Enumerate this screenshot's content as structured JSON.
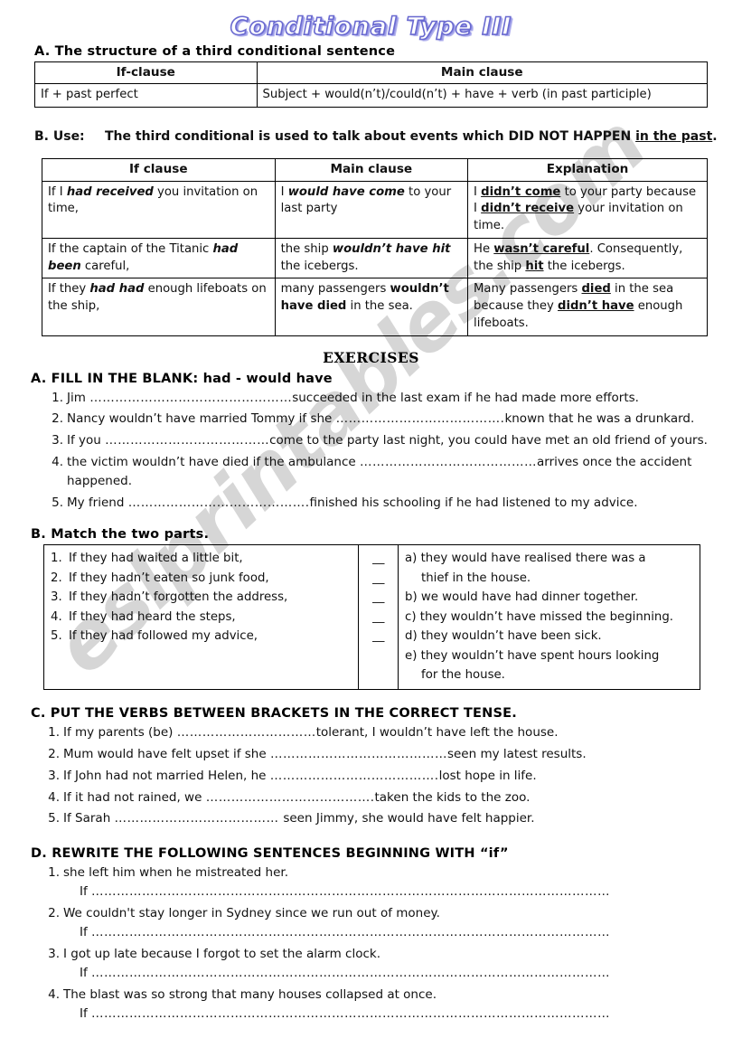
{
  "title": "Conditional Type III",
  "watermark": "eslprintables.com",
  "section_a": {
    "heading": "A. The structure of a third conditional sentence",
    "table": {
      "headers": [
        "If-clause",
        "Main clause"
      ],
      "rows": [
        [
          "If + past perfect",
          "Subject + would(n’t)/could(n’t) + have + verb (in past participle)"
        ]
      ]
    }
  },
  "section_b_use": {
    "label": "B. Use:",
    "text_before": "The third conditional is used to talk about events which DID NOT HAPPEN ",
    "text_underlined": "in the past",
    "text_after": ".",
    "table": {
      "headers": [
        "If clause",
        "Main clause",
        "Explanation"
      ],
      "rows": [
        {
          "if_clause": [
            {
              "t": "If I ",
              "s": "plain"
            },
            {
              "t": "had received",
              "s": "bold-italic"
            },
            {
              "t": " you invitation on time,",
              "s": "plain"
            }
          ],
          "main_clause": [
            {
              "t": "I ",
              "s": "plain"
            },
            {
              "t": "would have come",
              "s": "bold-italic"
            },
            {
              "t": " to your last party",
              "s": "plain"
            }
          ],
          "explanation": [
            {
              "t": "I ",
              "s": "plain"
            },
            {
              "t": "didn’t come",
              "s": "bold-underline"
            },
            {
              "t": " to your party because I ",
              "s": "plain"
            },
            {
              "t": "didn’t receive",
              "s": "bold-underline"
            },
            {
              "t": " your invitation on time.",
              "s": "plain"
            }
          ]
        },
        {
          "if_clause": [
            {
              "t": "If the captain of the Titanic ",
              "s": "plain"
            },
            {
              "t": "had been",
              "s": "bold-italic"
            },
            {
              "t": " careful,",
              "s": "plain"
            }
          ],
          "main_clause": [
            {
              "t": "the ship ",
              "s": "plain"
            },
            {
              "t": "wouldn’t have hit",
              "s": "bold-italic"
            },
            {
              "t": " the icebergs.",
              "s": "plain"
            }
          ],
          "explanation": [
            {
              "t": "He ",
              "s": "plain"
            },
            {
              "t": "wasn’t careful",
              "s": "bold-underline"
            },
            {
              "t": ". Consequently, the ship ",
              "s": "plain"
            },
            {
              "t": "hit",
              "s": "bold-underline"
            },
            {
              "t": " the icebergs.",
              "s": "plain"
            }
          ]
        },
        {
          "if_clause": [
            {
              "t": "If they ",
              "s": "plain"
            },
            {
              "t": "had had",
              "s": "bold-italic"
            },
            {
              "t": " enough lifeboats on the ship,",
              "s": "plain"
            }
          ],
          "main_clause": [
            {
              "t": "many passengers ",
              "s": "plain"
            },
            {
              "t": "wouldn’t have died",
              "s": "bold"
            },
            {
              "t": " in the sea.",
              "s": "plain"
            }
          ],
          "explanation": [
            {
              "t": "Many passengers ",
              "s": "plain"
            },
            {
              "t": "died",
              "s": "bold-underline"
            },
            {
              "t": " in the sea because they ",
              "s": "plain"
            },
            {
              "t": "didn’t have",
              "s": "bold-underline"
            },
            {
              "t": " enough lifeboats.",
              "s": "plain"
            }
          ]
        }
      ]
    }
  },
  "exercises_title": "EXERCISES",
  "exercise_a": {
    "heading": "A. FILL IN THE BLANK: had  -  would have",
    "items": [
      {
        "num": "1.",
        "before": "Jim ",
        "dots": "…………………………………………",
        "after": "succeeded in the last exam if he had made more efforts."
      },
      {
        "num": "2.",
        "before": "Nancy wouldn’t have married Tommy if she ",
        "dots": "………………………………….",
        "after": "known that he was a drunkard."
      },
      {
        "num": "3.",
        "before": "If you ",
        "dots": "…………………………………",
        "after": "come to the party last night, you could have met an old friend of yours."
      },
      {
        "num": "4.",
        "before": "the victim wouldn’t have died if the ambulance ",
        "dots": "……………………………………",
        "after": "arrives once the accident happened."
      },
      {
        "num": "5.",
        "before": "My friend ",
        "dots": "…………………………………….",
        "after": "finished his schooling if he had listened to my advice."
      }
    ]
  },
  "exercise_b": {
    "heading": "B. Match the two parts.",
    "left_items": [
      {
        "num": "1.",
        "text": "If they had waited a little bit,"
      },
      {
        "num": "2.",
        "text": "If they hadn’t eaten so junk food,"
      },
      {
        "num": "3.",
        "text": "If they hadn’t forgotten the address,"
      },
      {
        "num": "4.",
        "text": "If they had heard the steps,"
      },
      {
        "num": "5.",
        "text": "If they had followed my advice,"
      }
    ],
    "blank_marks": [
      "__",
      "__",
      "__",
      "__",
      "__"
    ],
    "right_items": [
      {
        "letter": "a)",
        "text": "they would have realised there was a",
        "cont": "thief in the house."
      },
      {
        "letter": "b)",
        "text": "we would have had dinner together.",
        "cont": ""
      },
      {
        "letter": "c)",
        "text": "they wouldn’t have missed the beginning.",
        "cont": ""
      },
      {
        "letter": "d)",
        "text": "they wouldn’t have been sick.",
        "cont": ""
      },
      {
        "letter": "e)",
        "text": "they wouldn’t have spent hours looking",
        "cont": "for the house."
      }
    ]
  },
  "exercise_c": {
    "heading": "C. PUT THE VERBS BETWEEN BRACKETS IN THE CORRECT TENSE.",
    "items": [
      {
        "num": "1.",
        "before": "If my parents (be) ",
        "dots": "……………………………",
        "after": "tolerant, I wouldn’t have left the house."
      },
      {
        "num": "2.",
        "before": "Mum would have felt upset if  she ",
        "dots": "……………………………………",
        "after": "seen my latest results."
      },
      {
        "num": "3.",
        "before": "If John had not married Helen, he ",
        "dots": "………………………………….",
        "after": "lost hope in life."
      },
      {
        "num": "4.",
        "before": "If it had not rained, we ",
        "dots": "………………………………….",
        "after": "taken the kids to the zoo."
      },
      {
        "num": "5.",
        "before": "If Sarah ",
        "dots": "………………………………… ",
        "after": "seen Jimmy, she would have felt happier."
      }
    ]
  },
  "exercise_d": {
    "heading": "D. REWRITE THE FOLLOWING SENTENCES BEGINNING WITH “if”",
    "if_label": "If",
    "answer_dots": "……………………………………………………………………………………………………………",
    "items": [
      {
        "num": "1.",
        "text": "she left him when he mistreated her."
      },
      {
        "num": "2.",
        "text": "We couldn't stay longer in Sydney since we run out of money."
      },
      {
        "num": "3.",
        "text": "I got up late because I forgot to set the alarm clock."
      },
      {
        "num": "4.",
        "text": "The blast was so strong that many houses collapsed at once."
      }
    ]
  }
}
